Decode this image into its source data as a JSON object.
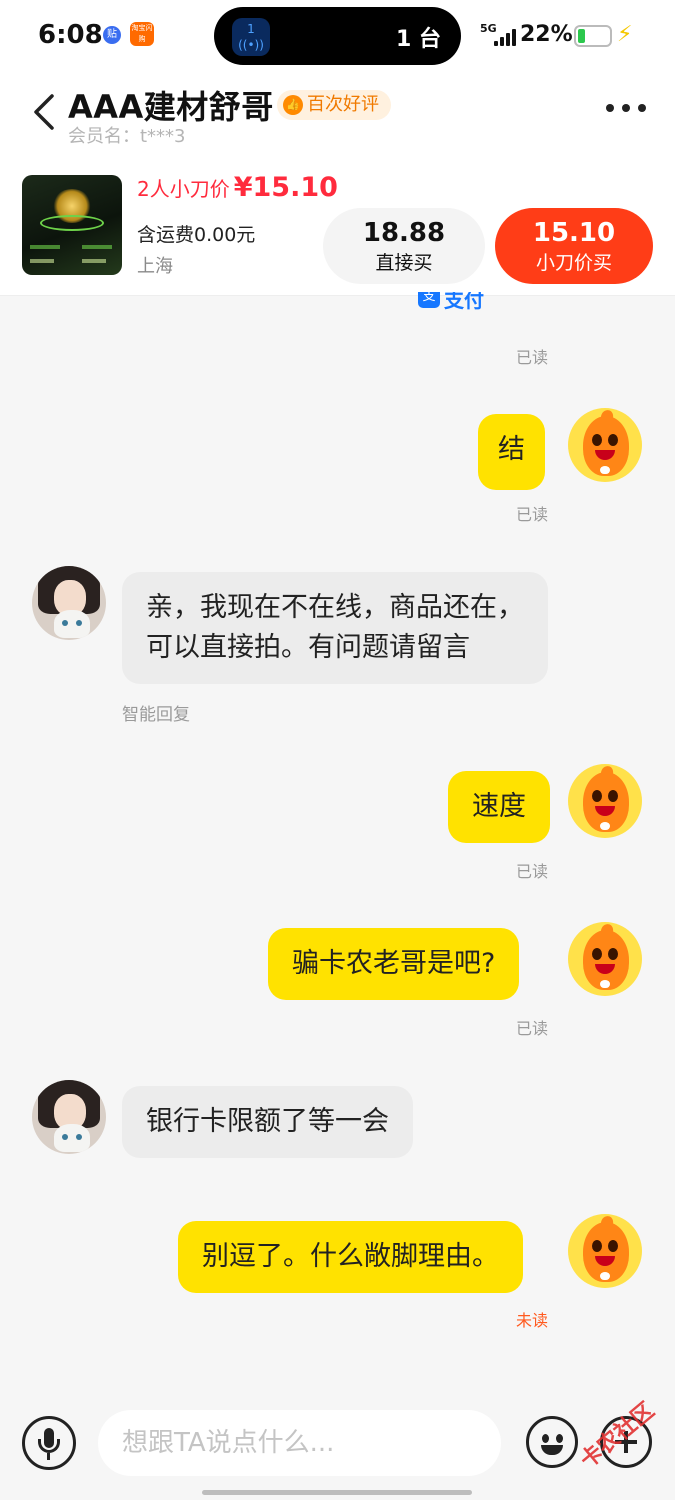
{
  "status_bar": {
    "time": "6:08",
    "app_badge_1": "贴",
    "app_badge_2": "淘宝闪购",
    "nfc_label": "1",
    "island_count": "1 台",
    "network": "5G",
    "battery_percent": "22%",
    "battery_level": 0.22
  },
  "header": {
    "title": "AAA建材舒哥",
    "badge": "百次好评",
    "member": "会员名：t***3"
  },
  "product": {
    "deal_label": "2人小刀价",
    "deal_price": "¥15.10",
    "shipping": "含运费0.00元",
    "location": "上海",
    "direct_price": "18.88",
    "direct_label": "直接买",
    "cut_price": "15.10",
    "cut_label": "小刀价买"
  },
  "chat": {
    "partial_alipay": "支付宝",
    "receipt_top": "已读",
    "messages": [
      {
        "sender": "me",
        "text": "结",
        "receipt": "已读"
      },
      {
        "sender": "them",
        "line1": "亲，我现在不在线，商品还在，",
        "line2": "可以直接拍。有问题请留言",
        "note": "智能回复"
      },
      {
        "sender": "me",
        "text": "速度",
        "receipt": "已读"
      },
      {
        "sender": "me",
        "text": "骗卡农老哥是吧?",
        "receipt": "已读"
      },
      {
        "sender": "them",
        "text": "银行卡限额了等一会"
      },
      {
        "sender": "me",
        "text": "别逗了。什么敞脚理由。",
        "receipt": "未读"
      }
    ]
  },
  "input_bar": {
    "placeholder": "想跟TA说点什么..."
  },
  "watermark": "卡农社区",
  "colors": {
    "my_bubble": "#ffe200",
    "their_bubble": "#ececec",
    "cut_button": "#ff3d17",
    "price_red": "#ff2b3d",
    "unread": "#ff5a1f"
  }
}
